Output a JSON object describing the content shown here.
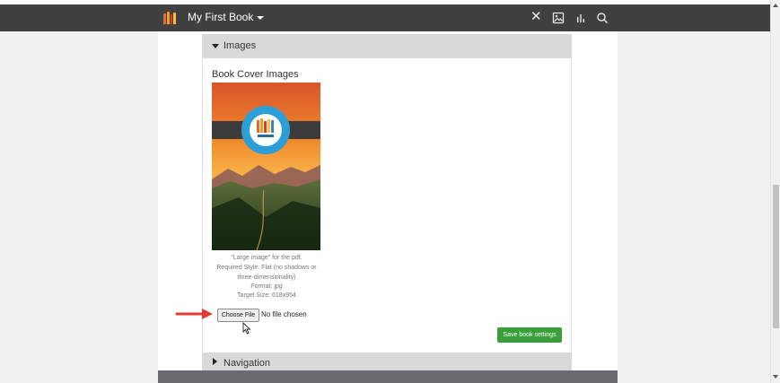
{
  "app": {
    "book_title": "My First Book"
  },
  "toolbar": {
    "close_icon": "close-icon",
    "image_icon": "image-icon",
    "stats_icon": "bar-chart-icon",
    "search_icon": "search-icon"
  },
  "images_section": {
    "header": "Images",
    "cover_label": "Book Cover Images",
    "caption": {
      "line1": "\"Large image\" for the pdf.",
      "line2": "Required Style: Flat (no shadows or",
      "line3": "three-dimensionality)",
      "line4": "Format: jpg",
      "line5": "Target Size: 618x954"
    },
    "choose_file_label": "Choose File",
    "file_status": "No file chosen",
    "save_label": "Save book settings"
  },
  "navigation_section": {
    "header": "Navigation"
  },
  "colors": {
    "accent_green": "#3a9f3a",
    "topbar": "#404040",
    "arrow_red": "#e53935"
  }
}
